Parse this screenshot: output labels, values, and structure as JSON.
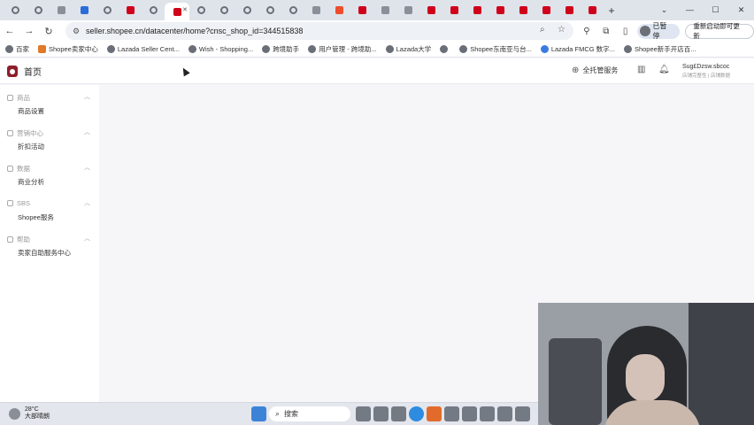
{
  "browser": {
    "url": "seller.shopee.cn/datacenter/home?cnsc_shop_id=344515838",
    "profile_status": "已暂停",
    "restart_label": "重新启动即可更新",
    "new_tab": "+",
    "window_controls": [
      "⌄",
      "—",
      "☐",
      "✕"
    ],
    "bookmarks": [
      {
        "label": "百家",
        "icon": "globe-icon"
      },
      {
        "label": "Shopee卖家中心",
        "icon": "shopee-icon"
      },
      {
        "label": "Lazada Seller Cent...",
        "icon": "globe-icon"
      },
      {
        "label": "Wish - Shopping...",
        "icon": "document-icon"
      },
      {
        "label": "跨境助手",
        "icon": "folder-icon"
      },
      {
        "label": "用户管理 - 跨境助...",
        "icon": "document-icon"
      },
      {
        "label": "Lazada大学",
        "icon": "folder-icon"
      },
      {
        "label": "",
        "icon": "globe-icon"
      },
      {
        "label": "Shopee东南亚与台...",
        "icon": "globe-icon"
      },
      {
        "label": "Lazada FMCG 数字...",
        "icon": "document-icon"
      },
      {
        "label": "Shopee新手开店百...",
        "icon": "document-icon"
      }
    ]
  },
  "app": {
    "title": "首页",
    "managed_service": "全托管服务",
    "user_name": "Sug£Dzsw.sbcoc",
    "user_sub": "店铺完整性 | 店铺数据"
  },
  "sidebar": [
    {
      "header": "商品",
      "item": "商品设置",
      "icon": "box-icon"
    },
    {
      "header": "营销中心",
      "item": "折扣活动",
      "icon": "tag-icon"
    },
    {
      "header": "数据",
      "item": "商业分析",
      "icon": "chart-icon"
    },
    {
      "header": "SBS",
      "item": "Shopee服务",
      "icon": "service-icon"
    },
    {
      "header": "帮助",
      "item": "卖家自助服务中心",
      "icon": "help-icon"
    }
  ],
  "taskbar": {
    "temperature": "28°C",
    "weather": "大部晴朗",
    "search_label": "搜索"
  }
}
